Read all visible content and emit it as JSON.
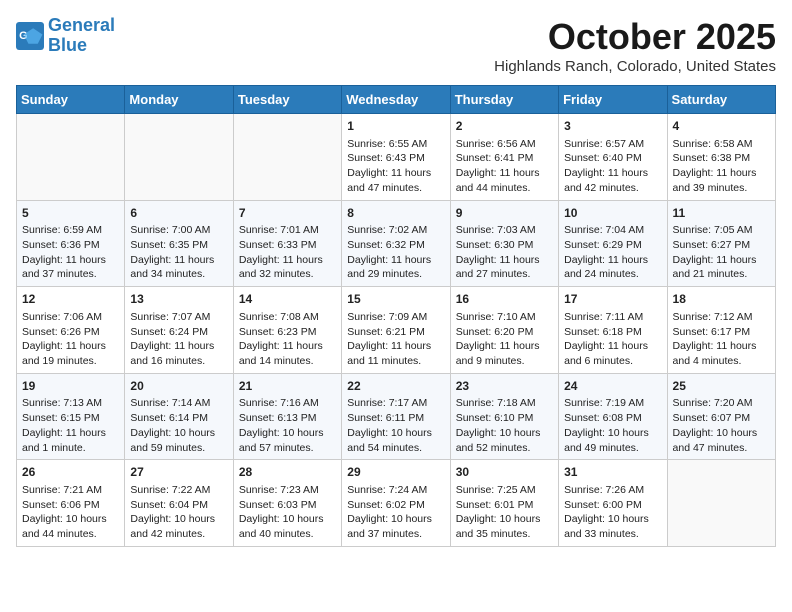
{
  "logo": {
    "line1": "General",
    "line2": "Blue"
  },
  "title": "October 2025",
  "location": "Highlands Ranch, Colorado, United States",
  "weekdays": [
    "Sunday",
    "Monday",
    "Tuesday",
    "Wednesday",
    "Thursday",
    "Friday",
    "Saturday"
  ],
  "weeks": [
    [
      {
        "day": "",
        "content": ""
      },
      {
        "day": "",
        "content": ""
      },
      {
        "day": "",
        "content": ""
      },
      {
        "day": "1",
        "content": "Sunrise: 6:55 AM\nSunset: 6:43 PM\nDaylight: 11 hours and 47 minutes."
      },
      {
        "day": "2",
        "content": "Sunrise: 6:56 AM\nSunset: 6:41 PM\nDaylight: 11 hours and 44 minutes."
      },
      {
        "day": "3",
        "content": "Sunrise: 6:57 AM\nSunset: 6:40 PM\nDaylight: 11 hours and 42 minutes."
      },
      {
        "day": "4",
        "content": "Sunrise: 6:58 AM\nSunset: 6:38 PM\nDaylight: 11 hours and 39 minutes."
      }
    ],
    [
      {
        "day": "5",
        "content": "Sunrise: 6:59 AM\nSunset: 6:36 PM\nDaylight: 11 hours and 37 minutes."
      },
      {
        "day": "6",
        "content": "Sunrise: 7:00 AM\nSunset: 6:35 PM\nDaylight: 11 hours and 34 minutes."
      },
      {
        "day": "7",
        "content": "Sunrise: 7:01 AM\nSunset: 6:33 PM\nDaylight: 11 hours and 32 minutes."
      },
      {
        "day": "8",
        "content": "Sunrise: 7:02 AM\nSunset: 6:32 PM\nDaylight: 11 hours and 29 minutes."
      },
      {
        "day": "9",
        "content": "Sunrise: 7:03 AM\nSunset: 6:30 PM\nDaylight: 11 hours and 27 minutes."
      },
      {
        "day": "10",
        "content": "Sunrise: 7:04 AM\nSunset: 6:29 PM\nDaylight: 11 hours and 24 minutes."
      },
      {
        "day": "11",
        "content": "Sunrise: 7:05 AM\nSunset: 6:27 PM\nDaylight: 11 hours and 21 minutes."
      }
    ],
    [
      {
        "day": "12",
        "content": "Sunrise: 7:06 AM\nSunset: 6:26 PM\nDaylight: 11 hours and 19 minutes."
      },
      {
        "day": "13",
        "content": "Sunrise: 7:07 AM\nSunset: 6:24 PM\nDaylight: 11 hours and 16 minutes."
      },
      {
        "day": "14",
        "content": "Sunrise: 7:08 AM\nSunset: 6:23 PM\nDaylight: 11 hours and 14 minutes."
      },
      {
        "day": "15",
        "content": "Sunrise: 7:09 AM\nSunset: 6:21 PM\nDaylight: 11 hours and 11 minutes."
      },
      {
        "day": "16",
        "content": "Sunrise: 7:10 AM\nSunset: 6:20 PM\nDaylight: 11 hours and 9 minutes."
      },
      {
        "day": "17",
        "content": "Sunrise: 7:11 AM\nSunset: 6:18 PM\nDaylight: 11 hours and 6 minutes."
      },
      {
        "day": "18",
        "content": "Sunrise: 7:12 AM\nSunset: 6:17 PM\nDaylight: 11 hours and 4 minutes."
      }
    ],
    [
      {
        "day": "19",
        "content": "Sunrise: 7:13 AM\nSunset: 6:15 PM\nDaylight: 11 hours and 1 minute."
      },
      {
        "day": "20",
        "content": "Sunrise: 7:14 AM\nSunset: 6:14 PM\nDaylight: 10 hours and 59 minutes."
      },
      {
        "day": "21",
        "content": "Sunrise: 7:16 AM\nSunset: 6:13 PM\nDaylight: 10 hours and 57 minutes."
      },
      {
        "day": "22",
        "content": "Sunrise: 7:17 AM\nSunset: 6:11 PM\nDaylight: 10 hours and 54 minutes."
      },
      {
        "day": "23",
        "content": "Sunrise: 7:18 AM\nSunset: 6:10 PM\nDaylight: 10 hours and 52 minutes."
      },
      {
        "day": "24",
        "content": "Sunrise: 7:19 AM\nSunset: 6:08 PM\nDaylight: 10 hours and 49 minutes."
      },
      {
        "day": "25",
        "content": "Sunrise: 7:20 AM\nSunset: 6:07 PM\nDaylight: 10 hours and 47 minutes."
      }
    ],
    [
      {
        "day": "26",
        "content": "Sunrise: 7:21 AM\nSunset: 6:06 PM\nDaylight: 10 hours and 44 minutes."
      },
      {
        "day": "27",
        "content": "Sunrise: 7:22 AM\nSunset: 6:04 PM\nDaylight: 10 hours and 42 minutes."
      },
      {
        "day": "28",
        "content": "Sunrise: 7:23 AM\nSunset: 6:03 PM\nDaylight: 10 hours and 40 minutes."
      },
      {
        "day": "29",
        "content": "Sunrise: 7:24 AM\nSunset: 6:02 PM\nDaylight: 10 hours and 37 minutes."
      },
      {
        "day": "30",
        "content": "Sunrise: 7:25 AM\nSunset: 6:01 PM\nDaylight: 10 hours and 35 minutes."
      },
      {
        "day": "31",
        "content": "Sunrise: 7:26 AM\nSunset: 6:00 PM\nDaylight: 10 hours and 33 minutes."
      },
      {
        "day": "",
        "content": ""
      }
    ]
  ]
}
